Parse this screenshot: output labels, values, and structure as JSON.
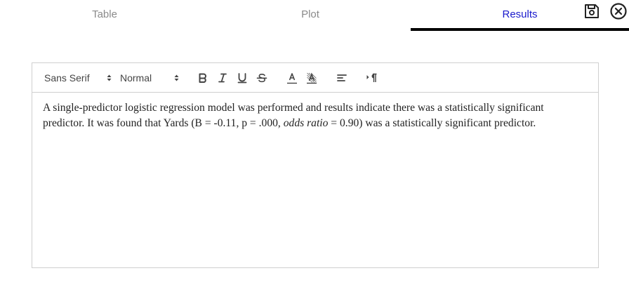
{
  "tabs": [
    {
      "label": "Table"
    },
    {
      "label": "Plot"
    },
    {
      "label": "Results",
      "active": true
    }
  ],
  "header_icons": [
    "save-icon",
    "close-circle-icon"
  ],
  "toolbar": {
    "font_select": "Sans Serif",
    "size_select": "Normal",
    "buttons": [
      "bold",
      "italic",
      "underline",
      "strikethrough",
      "text-color",
      "background-color",
      "align",
      "text-direction"
    ]
  },
  "results": {
    "text_before": "A single-predictor logistic regression model was performed and results indicate there was a statistically significant predictor. It was found that Yards (B = -0.11, p = .000, ",
    "text_italic": "odds ratio",
    "text_after": " = 0.90) was a statistically significant predictor."
  },
  "colors": {
    "active_tab": "#1a1acc",
    "inactive_tab": "#8a8a8a",
    "underline": "#000000"
  }
}
